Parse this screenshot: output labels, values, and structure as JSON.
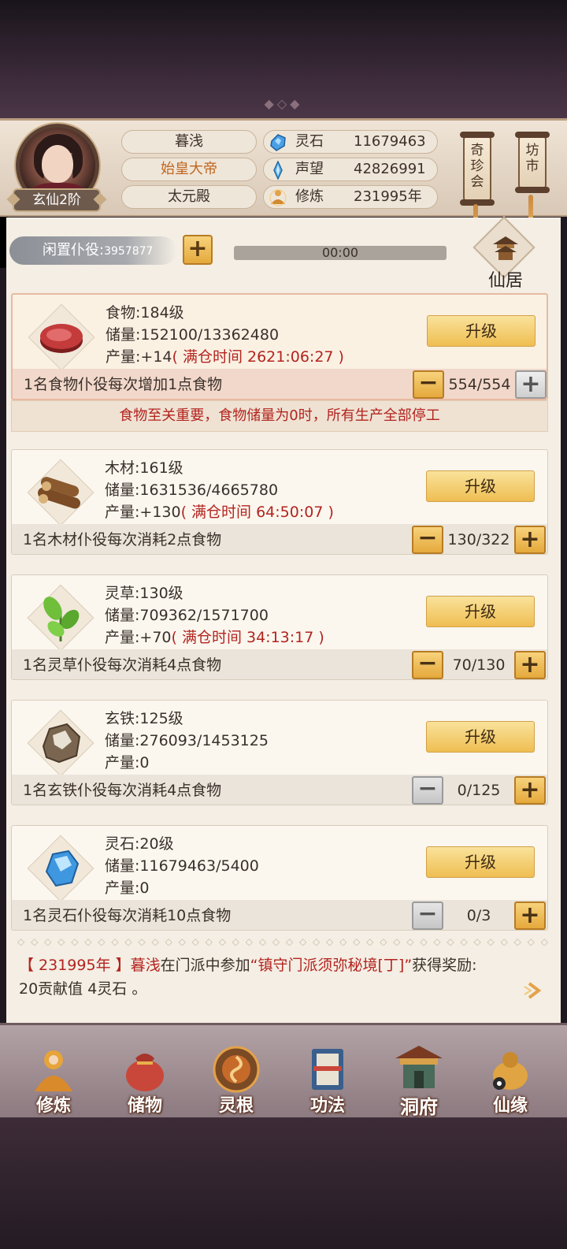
{
  "header": {
    "rank": "玄仙2阶",
    "name": "暮浅",
    "title": "始皇大帝",
    "palace": "太元殿",
    "resources": [
      {
        "icon": "spirit-stone-icon",
        "label": "灵石",
        "value": "11679463"
      },
      {
        "icon": "prestige-icon",
        "label": "声望",
        "value": "42826991"
      },
      {
        "icon": "cultivation-icon",
        "label": "修炼",
        "value": "231995年"
      }
    ],
    "shortcuts": [
      {
        "label": "奇珍会"
      },
      {
        "label": "坊市"
      }
    ]
  },
  "idle": {
    "label": "闲置仆役:",
    "count": "3957877",
    "add_label": "+"
  },
  "timer": "00:00",
  "xianju": "仙居",
  "resources": [
    {
      "key": "food",
      "name": "食物:184级",
      "storage": "储量:152100/13362480",
      "output": "产量:+14",
      "full": "( 满仓时间 2621:06:27 )",
      "upgrade": "升级",
      "desc": "1名食物仆役每次增加1点食物",
      "count": "554/554"
    },
    {
      "key": "wood",
      "name": "木材:161级",
      "storage": "储量:1631536/4665780",
      "output": "产量:+130",
      "full": "( 满仓时间 64:50:07 )",
      "upgrade": "升级",
      "desc": "1名木材仆役每次消耗2点食物",
      "count": "130/322"
    },
    {
      "key": "herb",
      "name": "灵草:130级",
      "storage": "储量:709362/1571700",
      "output": "产量:+70",
      "full": "( 满仓时间 34:13:17 )",
      "upgrade": "升级",
      "desc": "1名灵草仆役每次消耗4点食物",
      "count": "70/130"
    },
    {
      "key": "iron",
      "name": "玄铁:125级",
      "storage": "储量:276093/1453125",
      "output": "产量:0",
      "full": "",
      "upgrade": "升级",
      "desc": "1名玄铁仆役每次消耗4点食物",
      "count": "0/125"
    },
    {
      "key": "stone",
      "name": "灵石:20级",
      "storage": "储量:11679463/5400",
      "output": "产量:0",
      "full": "",
      "upgrade": "升级",
      "desc": "1名灵石仆役每次消耗10点食物",
      "count": "0/3"
    }
  ],
  "warning": "食物至关重要，食物储量为0时，所有生产全部停工",
  "log": {
    "year": "【 231995年 】",
    "name": "暮浅",
    "text1": "在门派中参加",
    "event": "“镇守门派须弥秘境[丁]”",
    "text2": "获得奖励:",
    "line2": "20贡献值 4灵石 。"
  },
  "nav": [
    {
      "label": "修炼",
      "icon": "cultivate-icon"
    },
    {
      "label": "储物",
      "icon": "storage-bag-icon"
    },
    {
      "label": "灵根",
      "icon": "spirit-root-icon"
    },
    {
      "label": "功法",
      "icon": "technique-book-icon"
    },
    {
      "label": "洞府",
      "icon": "cave-abode-icon"
    },
    {
      "label": "仙缘",
      "icon": "immortal-fate-icon"
    }
  ],
  "colors": {
    "accent_gold": "#efbe52",
    "warning_red": "#b3241f",
    "panel_bg": "#f4eee4"
  }
}
